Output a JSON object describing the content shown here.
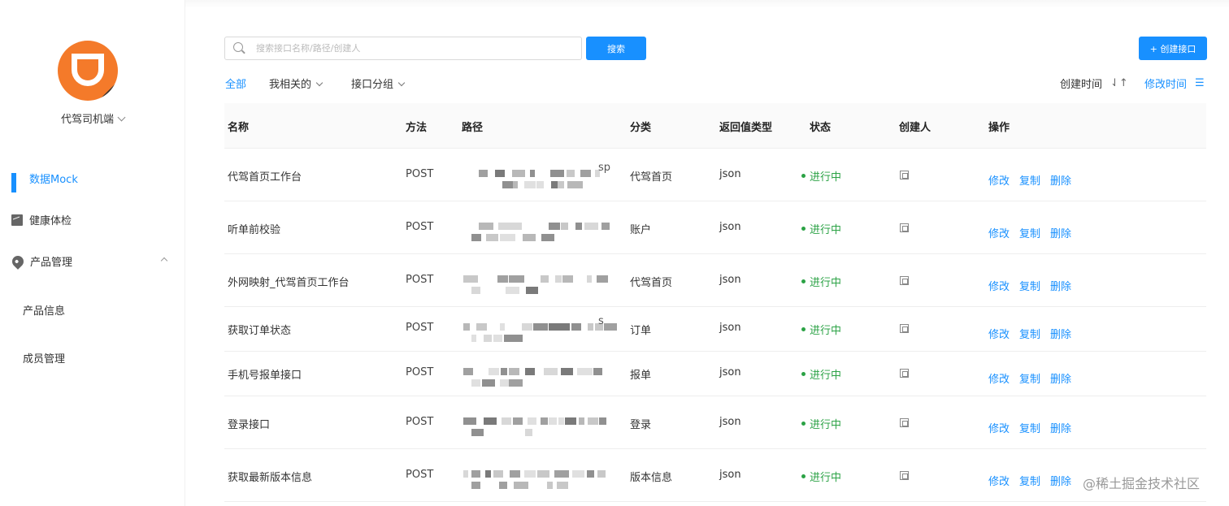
{
  "sidebar": {
    "org_name": "代驾司机端",
    "nav": [
      {
        "label": "数据Mock",
        "icon": "grid-icon",
        "active": true
      },
      {
        "label": "健康体检",
        "icon": "chart-icon",
        "active": false
      },
      {
        "label": "产品管理",
        "icon": "location-icon",
        "active": false
      }
    ],
    "sub_items": [
      "产品信息",
      "成员管理"
    ]
  },
  "toolbar": {
    "search_placeholder": "搜索接口名称/路径/创建人",
    "search_value": "",
    "search_label": "搜索",
    "create_label": "+ 创建接口"
  },
  "filters": {
    "all": "全部",
    "mine": "我相关的",
    "group": "接口分组"
  },
  "sort": {
    "created": "创建时间",
    "created_icon": "⇃↑",
    "modified": "修改时间",
    "modified_icon": "☰"
  },
  "table": {
    "headers": [
      "名称",
      "方法",
      "路径",
      "分类",
      "返回值类型",
      "状态",
      "创建人",
      "操作"
    ],
    "rows": [
      {
        "name": "代驾首页工作台",
        "method": "POST",
        "path_tail": "sp",
        "category": "代驾首页",
        "return_type": "json",
        "status": "进行中"
      },
      {
        "name": "听单前校验",
        "method": "POST",
        "path_tail": "",
        "category": "账户",
        "return_type": "json",
        "status": "进行中"
      },
      {
        "name": "外网映射_代驾首页工作台",
        "method": "POST",
        "path_tail": "",
        "category": "代驾首页",
        "return_type": "json",
        "status": "进行中"
      },
      {
        "name": "获取订单状态",
        "method": "POST",
        "path_tail": "s",
        "category": "订单",
        "return_type": "json",
        "status": "进行中"
      },
      {
        "name": "手机号报单接口",
        "method": "POST",
        "path_tail": "",
        "category": "报单",
        "return_type": "json",
        "status": "进行中"
      },
      {
        "name": "登录接口",
        "method": "POST",
        "path_tail": "",
        "category": "登录",
        "return_type": "json",
        "status": "进行中"
      },
      {
        "name": "获取最新版本信息",
        "method": "POST",
        "path_tail": "",
        "category": "版本信息",
        "return_type": "json",
        "status": "进行中"
      }
    ],
    "actions": [
      "修改",
      "复制",
      "删除"
    ]
  },
  "watermark": "@稀土掘金技术社区",
  "colors": {
    "accent": "#1890ff",
    "status_green": "#2ba245",
    "logo_orange": "#f47a2a"
  }
}
